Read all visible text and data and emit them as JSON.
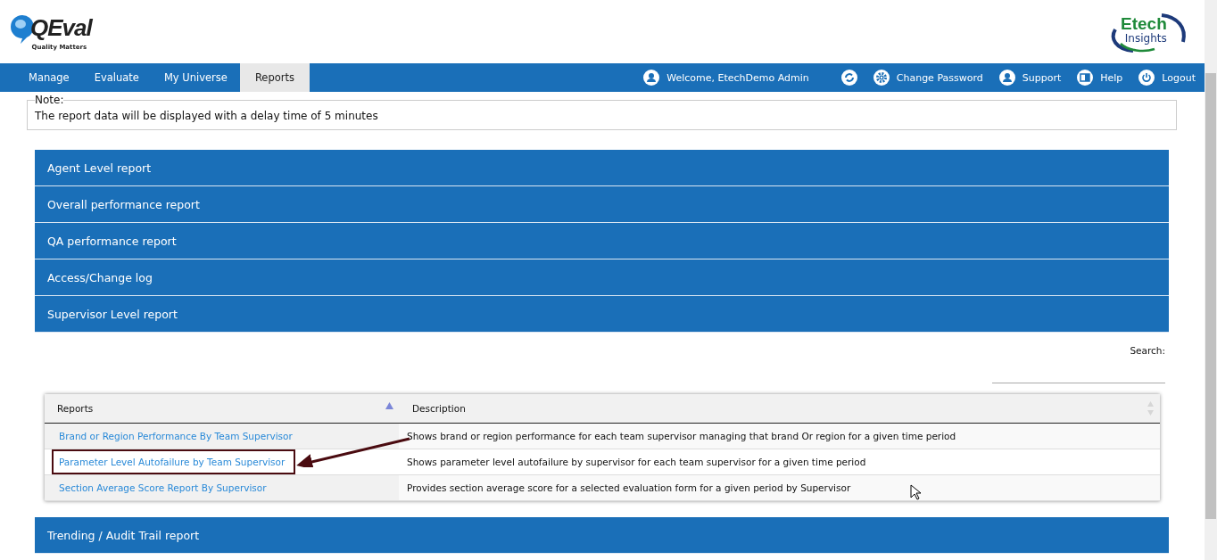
{
  "brand": {
    "name": "QEval",
    "tagline": "Quality Matters"
  },
  "partner_logo": {
    "name": "Etech",
    "sub": "Insights"
  },
  "nav": {
    "tabs": [
      {
        "label": "Manage",
        "selected": false
      },
      {
        "label": "Evaluate",
        "selected": false
      },
      {
        "label": "My Universe",
        "selected": false
      },
      {
        "label": "Reports",
        "selected": true
      }
    ],
    "user_items": [
      {
        "kind": "user",
        "label": "Welcome, EtechDemo Admin"
      },
      {
        "kind": "sync"
      },
      {
        "kind": "gear",
        "label": "Change Password"
      },
      {
        "kind": "support",
        "label": "Support"
      },
      {
        "kind": "help",
        "label": "Help"
      },
      {
        "kind": "power",
        "label": "Logout"
      }
    ]
  },
  "note": {
    "legend": "Note:",
    "text": "The report data will be displayed with a delay time of 5 minutes"
  },
  "sections": [
    {
      "title": "Agent Level report"
    },
    {
      "title": "Overall performance report"
    },
    {
      "title": "QA performance report"
    },
    {
      "title": "Access/Change log"
    },
    {
      "title": "Supervisor Level report",
      "search_label": "Search:",
      "table": {
        "columns": [
          {
            "label": "Reports",
            "sorted": true
          },
          {
            "label": "Description",
            "sorted": false
          }
        ],
        "rows": [
          {
            "report": "Brand or Region Performance By Team Supervisor",
            "description": "Shows brand or region performance for each team supervisor managing that brand Or region for a given time period",
            "highlighted": false
          },
          {
            "report": "Parameter Level Autofailure by Team Supervisor",
            "description": "Shows parameter level autofailure by supervisor for each team supervisor for a given time period",
            "highlighted": true
          },
          {
            "report": "Section Average Score Report By Supervisor",
            "description": "Provides section average score for a selected evaluation form for a given period by Supervisor",
            "highlighted": false
          }
        ]
      }
    },
    {
      "title": "Trending / Audit Trail report"
    }
  ]
}
